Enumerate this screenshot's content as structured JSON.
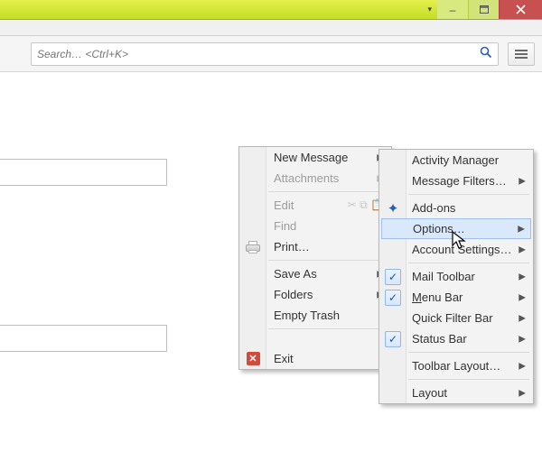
{
  "window_controls": {
    "dropdown": "▾",
    "minimize": "–",
    "maximize": "▢",
    "close": "×"
  },
  "search": {
    "placeholder": "Search… <Ctrl+K>"
  },
  "menu1": {
    "new_message": "New Message",
    "attachments": "Attachments",
    "edit": "Edit",
    "find": "Find",
    "print": "Print…",
    "save_as": "Save As",
    "folders": "Folders",
    "empty_trash": "Empty Trash",
    "exit": "Exit"
  },
  "menu2": {
    "activity_manager": "Activity Manager",
    "message_filters": "Message Filters…",
    "addons": "Add-ons",
    "options": "Options…",
    "account_settings": "Account Settings…",
    "mail_toolbar": "Mail Toolbar",
    "menu_bar": "Menu Bar",
    "quick_filter_bar": "Quick Filter Bar",
    "status_bar": "Status Bar",
    "toolbar_layout": "Toolbar Layout…",
    "layout": "Layout"
  }
}
